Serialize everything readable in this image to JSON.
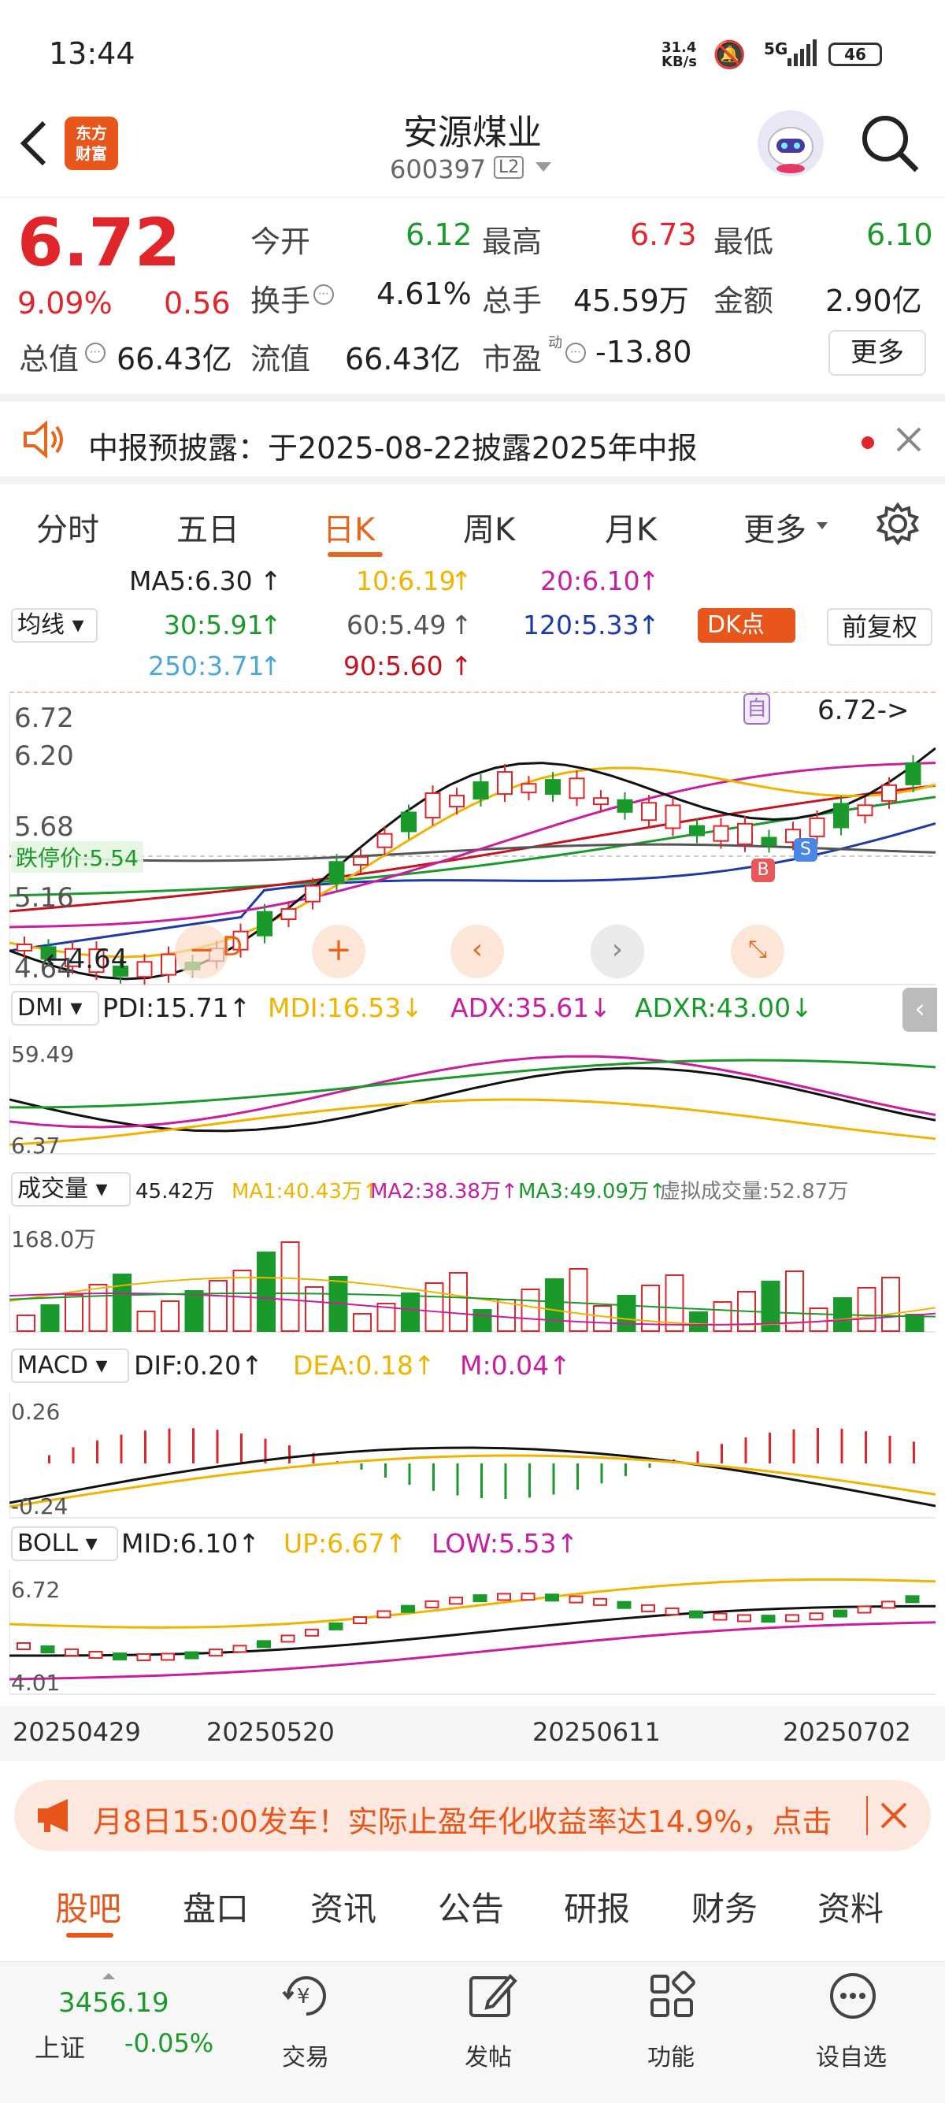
{
  "status": {
    "time": "13:44",
    "net_speed_top": "31.4",
    "net_speed_bottom": "KB/s",
    "signal": "5G",
    "battery": "46"
  },
  "header": {
    "logo_line1": "东方",
    "logo_line2": "财富",
    "title": "安源煤业",
    "code": "600397",
    "level": "L2"
  },
  "quote": {
    "price": "6.72",
    "pct": "9.09%",
    "change": "0.56",
    "open_label": "今开",
    "open": "6.12",
    "high_label": "最高",
    "high": "6.73",
    "low_label": "最低",
    "low": "6.10",
    "turnover_label": "换手",
    "turnover": "4.61%",
    "volume_label": "总手",
    "volume": "45.59万",
    "amount_label": "金额",
    "amount": "2.90亿",
    "mktcap_label": "总值",
    "mktcap": "66.43亿",
    "float_label": "流值",
    "float": "66.43亿",
    "pe_label": "市盈",
    "pe_sup": "动",
    "pe": "-13.80",
    "more_button": "更多"
  },
  "notice": {
    "text": "中报预披露：于2025-08-22披露2025年中报"
  },
  "tabs": [
    "分时",
    "五日",
    "日K",
    "周K",
    "月K",
    "更多"
  ],
  "active_tab": 2,
  "ma": {
    "selector": "均线",
    "ma5": "MA5:6.30",
    "ma10": "10:6.19",
    "ma20": "20:6.10",
    "ma30": "30:5.91",
    "ma60": "60:5.49",
    "ma120": "120:5.33",
    "ma250": "250:3.71",
    "ma90": "90:5.60",
    "dk_button": "DK点",
    "fq_button": "前复权"
  },
  "kline": {
    "ymax_label": "6.72",
    "y2": "6.20",
    "y3": "5.68",
    "y4": "5.16",
    "ymin_label": "4.64",
    "limit_down": "跌停价:5.54",
    "last_marker": "6.72->",
    "low_marker": "4.64",
    "marker_self": "自",
    "marker_b": "B",
    "marker_s": "S",
    "badge_d": "D"
  },
  "dmi": {
    "selector": "DMI",
    "pdi": "PDI:15.71",
    "mdi": "MDI:16.53",
    "adx": "ADX:35.61",
    "adxr": "ADXR:43.00",
    "ymax": "59.49",
    "ymin": "6.37"
  },
  "vol": {
    "selector": "成交量",
    "v": "45.42万",
    "ma1": "MA1:40.43万",
    "ma2": "MA2:38.38万",
    "ma3": "MA3:49.09万",
    "virtual": "虚拟成交量:52.87万",
    "ymax": "168.0万"
  },
  "macd": {
    "selector": "MACD",
    "dif": "DIF:0.20",
    "dea": "DEA:0.18",
    "m": "M:0.04",
    "ymax": "0.26",
    "ymin": "-0.24"
  },
  "boll": {
    "selector": "BOLL",
    "mid": "MID:6.10",
    "up": "UP:6.67",
    "low": "LOW:5.53",
    "ymax": "6.72",
    "ymin": "4.01"
  },
  "dates": [
    "20250429",
    "20250520",
    "20250611",
    "20250702"
  ],
  "promo": {
    "text": "月8日15:00发车！实际止盈年化收益率达14.9%，点击"
  },
  "bottom_tabs": [
    "股吧",
    "盘口",
    "资讯",
    "公告",
    "研报",
    "财务",
    "资料"
  ],
  "bottom_bar": {
    "index_value": "3456.19",
    "index_name": "上证",
    "index_pct": "-0.05%",
    "trade": "交易",
    "post": "发帖",
    "func": "功能",
    "watch": "设自选"
  },
  "colors": {
    "red": "#e0262b",
    "green": "#1a9a2a",
    "orange": "#e8661c",
    "ma10": "#f0b400",
    "ma20": "#c81ea0",
    "ma30": "#1a9a2a",
    "ma60": "#555555",
    "ma120": "#1d3aa8",
    "ma250": "#4aa8d8",
    "ma90": "#c4141e"
  }
}
